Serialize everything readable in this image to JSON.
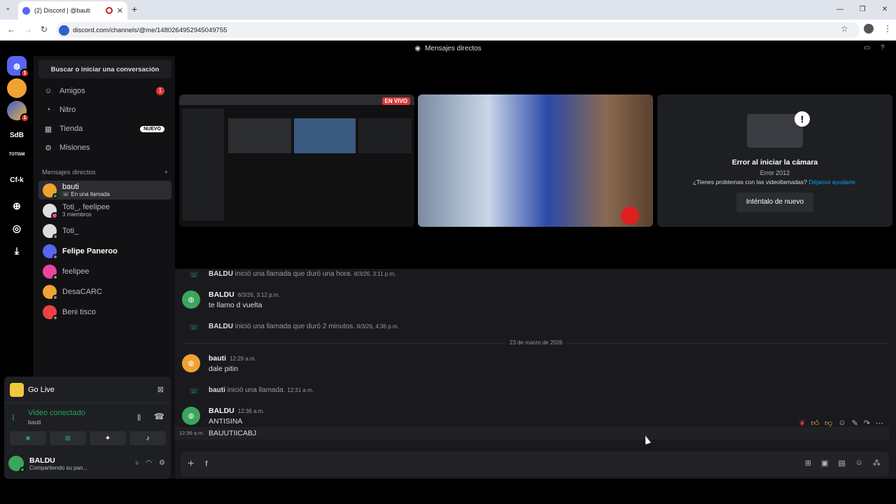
{
  "browser": {
    "tab_title": "(2) Discord | @bauti",
    "url": "discord.com/channels/@me/1480264952945049755"
  },
  "app": {
    "title": "Mensajes directos"
  },
  "guilds": [
    {
      "label": "",
      "badge": "1"
    },
    {
      "label": "",
      "badge": ""
    },
    {
      "label": "",
      "badge": "1"
    },
    {
      "label": "SdB"
    },
    {
      "label": "TOTISM"
    },
    {
      "label": "Cf-k"
    }
  ],
  "sidebar": {
    "search": "Buscar o iniciar una conversación",
    "nav": [
      {
        "label": "Amigos",
        "badge": "1"
      },
      {
        "label": "Nitro"
      },
      {
        "label": "Tienda",
        "tag": "NUEVO"
      },
      {
        "label": "Misiones"
      }
    ],
    "dm_header": "Mensajes directos",
    "dms": [
      {
        "name": "bauti",
        "sub": "En una llamada",
        "color": "#f0a232"
      },
      {
        "name": "Toti_, feelipee",
        "sub": "3 miembros",
        "color": "#dddddd"
      },
      {
        "name": "Toti_",
        "sub": "",
        "color": "#dddddd"
      },
      {
        "name": "Felipe Paneroo",
        "sub": "",
        "color": "#5865f2"
      },
      {
        "name": "feelipee",
        "sub": "",
        "color": "#eb459e"
      },
      {
        "name": "DesaCARC",
        "sub": "",
        "color": "#f0a232"
      },
      {
        "name": "Beni tisco",
        "sub": "",
        "color": "#ed4245"
      }
    ]
  },
  "voice": {
    "golive": "Go Live",
    "status": "Video conectado",
    "channel": "bauti"
  },
  "user": {
    "name": "BALDU",
    "status": "Compartiendo su pan..."
  },
  "stage": {
    "live_badge": "EN VIVO",
    "cam_error_title": "Error al iniciar la cámara",
    "cam_error_code": "Error 2012",
    "cam_error_help": "¿Tienes problemas con las videollamadas?",
    "cam_error_link": "Déjanos ayudarte.",
    "retry": "Inténtalo de nuevo"
  },
  "chat": {
    "m1": {
      "user": "BALDU",
      "text": "inició una llamada que duró una hora.",
      "time": "8/3/26, 3:11 p.m."
    },
    "m2": {
      "user": "BALDU",
      "time": "8/3/26, 3:12 p.m.",
      "text": "te llamo d vuelta"
    },
    "m3": {
      "user": "BALDU",
      "text": "inició una llamada que duró 2 minutos.",
      "time": "8/3/26, 4:36 p.m."
    },
    "date": "23 de marzo de 2026",
    "m4": {
      "user": "bauti",
      "time": "12:29 a.m.",
      "text": "dale pitin"
    },
    "m5": {
      "user": "bauti",
      "text": "inició una llamada.",
      "time": "12:31 a.m."
    },
    "m6": {
      "user": "BALDU",
      "time": "12:36 a.m.",
      "text": "ANTISINA"
    },
    "m7": {
      "time": "12:36 a.m.",
      "text": "BAUUTIICABJ"
    },
    "composer_text": "f"
  }
}
